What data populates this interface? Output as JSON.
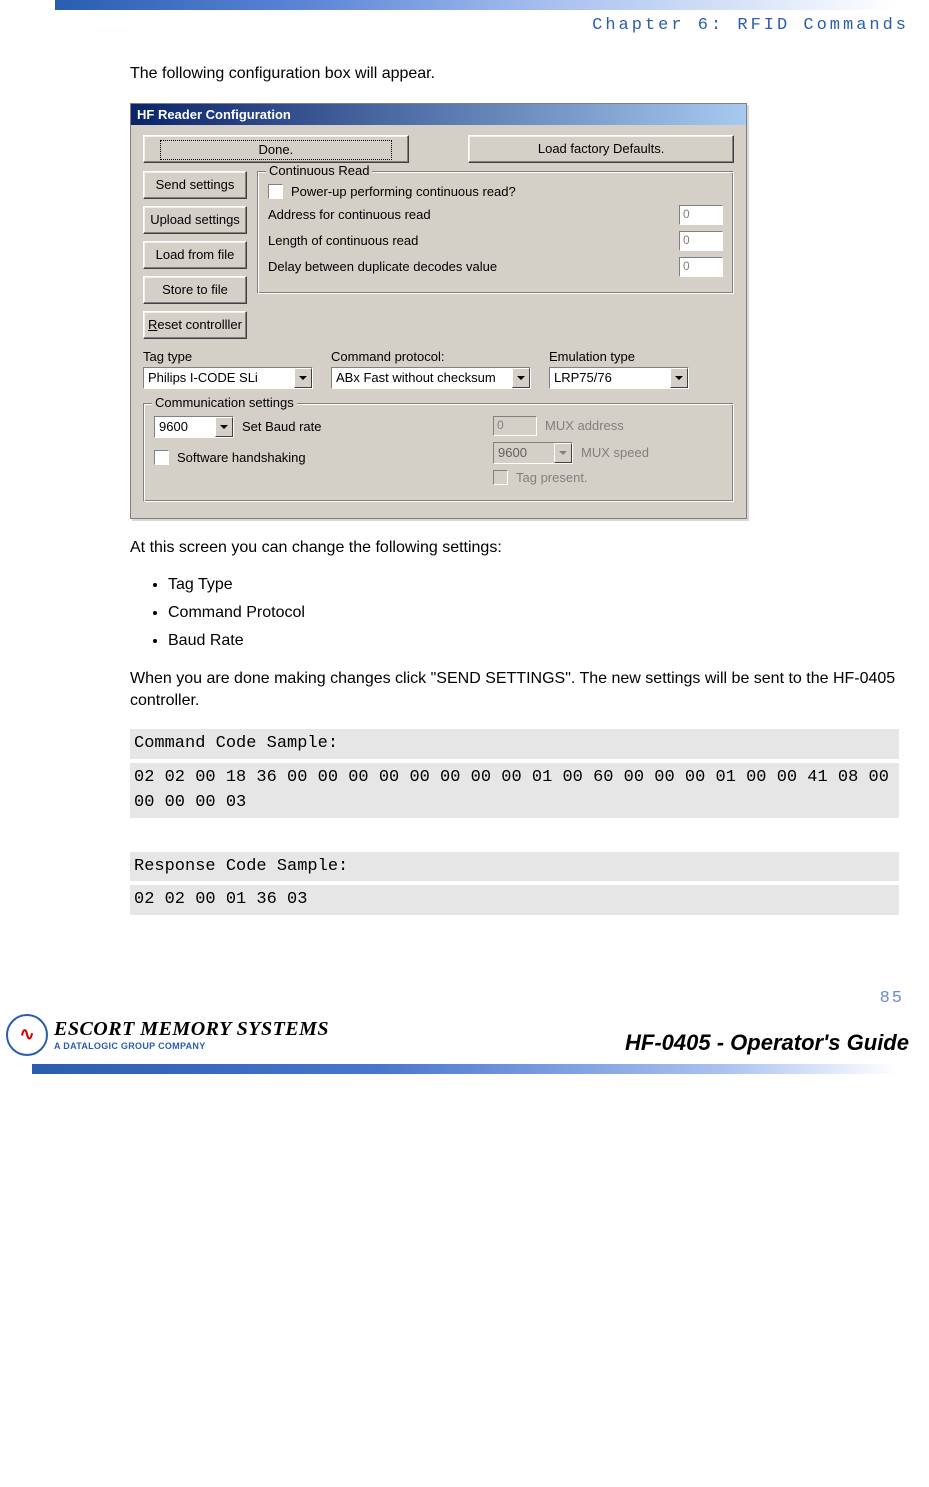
{
  "header": {
    "chapter": "Chapter 6: RFID Commands"
  },
  "intro": "The following configuration box will appear.",
  "dialog": {
    "title": "HF Reader Configuration",
    "top_buttons": {
      "done": "Done.",
      "load_defaults": "Load factory Defaults."
    },
    "side_buttons": {
      "send": "Send settings",
      "upload": "Upload settings",
      "load_file": "Load from file",
      "store_file": "Store to file",
      "reset": "Reset controlller"
    },
    "cont_read": {
      "legend": "Continuous Read",
      "powerup": "Power-up performing continuous read?",
      "addr_label": "Address for continuous read",
      "addr_val": "0",
      "len_label": "Length of continuous read",
      "len_val": "0",
      "delay_label": "Delay between duplicate decodes value",
      "delay_val": "0"
    },
    "combos": {
      "tag_label": "Tag type",
      "tag_val": "Philips I-CODE SLi",
      "proto_label": "Command protocol:",
      "proto_val": "ABx Fast without checksum",
      "emu_label": "Emulation type",
      "emu_val": "LRP75/76"
    },
    "comm": {
      "legend": "Communication settings",
      "baud_val": "9600",
      "baud_label": "Set Baud rate",
      "handshake": "Software handshaking",
      "mux_addr_val": "0",
      "mux_addr_label": "MUX address",
      "mux_speed_val": "9600",
      "mux_speed_label": "MUX speed",
      "tag_present": "Tag present."
    }
  },
  "after_text": "At this screen you can change the following settings:",
  "bullets": [
    "Tag Type",
    "Command Protocol",
    "Baud Rate"
  ],
  "done_text": "When you are done making changes click \"SEND SETTINGS\". The new settings will be sent to the HF-0405 controller.",
  "code1": {
    "label": "Command Code Sample:",
    "body": "02 02 00 18 36 00 00 00 00 00 00 00 00 01 00 60 00 00 00 01 00 00 41 08 00 00 00 00 03"
  },
  "code2": {
    "label": "Response Code Sample:",
    "body": "02 02 00 01 36 03"
  },
  "page_number": "85",
  "footer": {
    "logo1": "ESCORT MEMORY SYSTEMS",
    "logo2": "A DATALOGIC GROUP COMPANY",
    "guide": "HF-0405 - Operator's Guide"
  }
}
